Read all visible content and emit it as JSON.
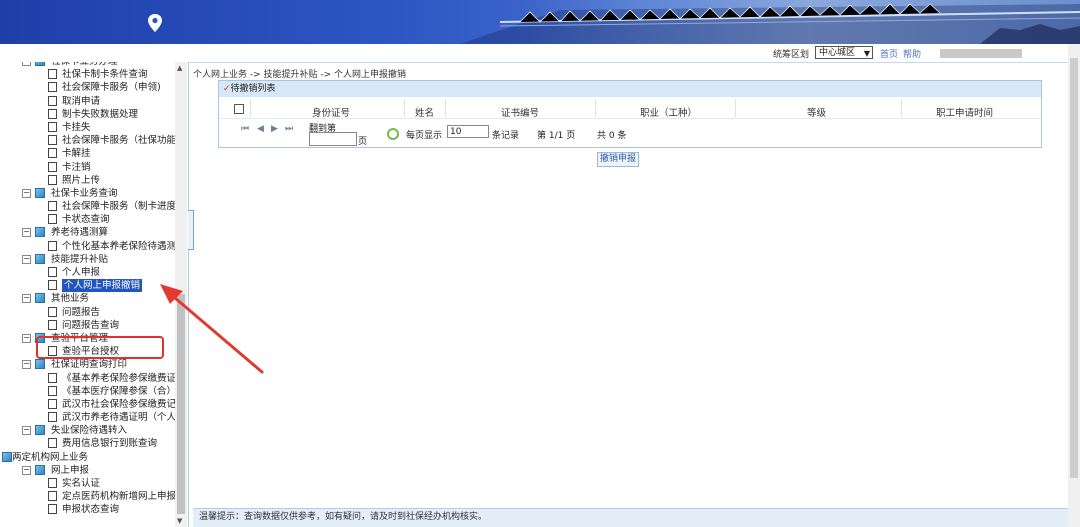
{
  "header": {
    "district_label": "统筹区划",
    "district_value": "中心城区",
    "home_link": "首页",
    "help_link": "帮助"
  },
  "sidebar": {
    "items": [
      {
        "label": "社保卡业务办理",
        "level": 1,
        "kind": "group"
      },
      {
        "label": "社保卡制卡条件查询",
        "level": 2,
        "kind": "leaf"
      },
      {
        "label": "社会保障卡服务（申领)",
        "level": 2,
        "kind": "leaf"
      },
      {
        "label": "取消申请",
        "level": 2,
        "kind": "leaf"
      },
      {
        "label": "制卡失败数据处理",
        "level": 2,
        "kind": "leaf"
      },
      {
        "label": "卡挂失",
        "level": 2,
        "kind": "leaf"
      },
      {
        "label": "社会保障卡服务（社保功能",
        "level": 2,
        "kind": "leaf"
      },
      {
        "label": "卡解挂",
        "level": 2,
        "kind": "leaf"
      },
      {
        "label": "卡注销",
        "level": 2,
        "kind": "leaf"
      },
      {
        "label": "照片上传",
        "level": 2,
        "kind": "leaf"
      },
      {
        "label": "社保卡业务查询",
        "level": 1,
        "kind": "group"
      },
      {
        "label": "社会保障卡服务（制卡进度",
        "level": 2,
        "kind": "leaf"
      },
      {
        "label": "卡状态查询",
        "level": 2,
        "kind": "leaf"
      },
      {
        "label": "养老待遇测算",
        "level": 1,
        "kind": "group"
      },
      {
        "label": "个性化基本养老保险待遇测",
        "level": 2,
        "kind": "leaf"
      },
      {
        "label": "技能提升补贴",
        "level": 1,
        "kind": "group"
      },
      {
        "label": "个人申报",
        "level": 2,
        "kind": "leaf"
      },
      {
        "label": "个人网上申报撤销",
        "level": 2,
        "kind": "leaf",
        "selected": true
      },
      {
        "label": "其他业务",
        "level": 1,
        "kind": "group"
      },
      {
        "label": "问题报告",
        "level": 2,
        "kind": "leaf"
      },
      {
        "label": "问题报告查询",
        "level": 2,
        "kind": "leaf"
      },
      {
        "label": "查验平台管理",
        "level": 1,
        "kind": "group"
      },
      {
        "label": "查验平台授权",
        "level": 2,
        "kind": "leaf"
      },
      {
        "label": "社保证明查询打印",
        "level": 1,
        "kind": "group"
      },
      {
        "label": "《基本养老保险参保缴费证",
        "level": 2,
        "kind": "leaf"
      },
      {
        "label": "《基本医疗保障参保（合）",
        "level": 2,
        "kind": "leaf"
      },
      {
        "label": "武汉市社会保险参保缴费记",
        "level": 2,
        "kind": "leaf"
      },
      {
        "label": "武汉市养老待遇证明（个人",
        "level": 2,
        "kind": "leaf"
      },
      {
        "label": "失业保险待遇转入",
        "level": 1,
        "kind": "group"
      },
      {
        "label": "费用信息银行到账查询",
        "level": 2,
        "kind": "leaf"
      },
      {
        "label": "两定机构网上业务",
        "level": 0,
        "kind": "root"
      },
      {
        "label": "网上申报",
        "level": 1,
        "kind": "group"
      },
      {
        "label": "实名认证",
        "level": 2,
        "kind": "leaf"
      },
      {
        "label": "定点医药机构新增网上申报",
        "level": 2,
        "kind": "leaf"
      },
      {
        "label": "申报状态查询",
        "level": 2,
        "kind": "leaf"
      }
    ]
  },
  "main": {
    "breadcrumb": "个人网上业务 -> 技能提升补贴 -> 个人网上申报撤销",
    "panel_title": "待撤销列表",
    "columns": [
      "身份证号",
      "姓名",
      "证书编号",
      "职业（工种）",
      "等级",
      "职工申请时间"
    ],
    "pager": {
      "goto_label": "翻到第",
      "page_suffix": "页",
      "per_page_label": "每页显示",
      "per_page_value": "10",
      "records_label": "条记录",
      "page_info": "第 1/1 页",
      "total_info": "共  0  条"
    },
    "cancel_button": "撤销申报"
  },
  "footer": {
    "tip": "温馨提示：查询数据仅供参考，如有疑问，请及时到社保经办机构核实。"
  },
  "colors": {
    "banner": "#2c55c4",
    "panel_title_bg": "#d7e7f8",
    "selection": "#2255c0",
    "annotation_red": "#e03030"
  }
}
